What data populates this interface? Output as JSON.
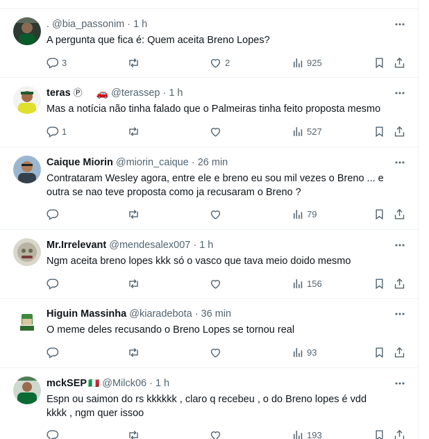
{
  "tweets": [
    {
      "name": "",
      "handle": ". @bia_passonim",
      "time": "1 h",
      "text": "A pergunta que fica é: Quem aceita Breno Lopes?",
      "replies": "3",
      "retweets": "",
      "likes": "2",
      "views": "925"
    },
    {
      "name": "teras",
      "badge": "Ⓟ",
      "emoji": "🚗",
      "handle": "@terassep",
      "time": "1 h",
      "text": "Mas a notícia não tinha falado que o Palmeiras tinha feito proposta mesmo",
      "replies": "1",
      "retweets": "",
      "likes": "",
      "views": "527"
    },
    {
      "name": "Caique Miorin",
      "handle": "@miorin_caique",
      "time": "26 min",
      "text_line1": "Contrataram Wesley agora, entre ele e breno eu sou mil vezes o Breno ... e",
      "text_line2": "outra se nao teve proposta como ja recusaram o Breno ?",
      "replies": "",
      "retweets": "",
      "likes": "",
      "views": "79"
    },
    {
      "name": "Mr.Irrelevant",
      "handle": "@mendesalex007",
      "time": "1 h",
      "text": "Ngm aceita breno lopes kkk só o vasco que tava meio doido mesmo",
      "replies": "",
      "retweets": "",
      "likes": "",
      "views": "156"
    },
    {
      "name": "Higuin Massinha",
      "handle": "@kiaradebota",
      "time": "36 min",
      "text": "O meme deles recusando o Breno Lopes se tornou real",
      "replies": "",
      "retweets": "",
      "likes": "",
      "views": "93"
    },
    {
      "name": "mckSEP",
      "flag": "🇮🇹",
      "handle": "@Milck06",
      "time": "1 h",
      "text_line1": "Espn ou saimon do rs kkkkkk , claro q recebeu , o do Breno lopes é vdd",
      "text_line2": "kkkk , ngm quer issoo",
      "replies": "",
      "retweets": "",
      "likes": "",
      "views": "193"
    }
  ],
  "separator": "·",
  "icons": {
    "reply": "reply-icon",
    "retweet": "retweet-icon",
    "like": "heart-icon",
    "views": "views-icon",
    "bookmark": "bookmark-icon",
    "share": "share-icon",
    "more": "more-icon"
  },
  "colors": {
    "text": "#0f1419",
    "muted": "#536471",
    "border": "#eff3f4",
    "palmeiras_green": "#006437"
  }
}
